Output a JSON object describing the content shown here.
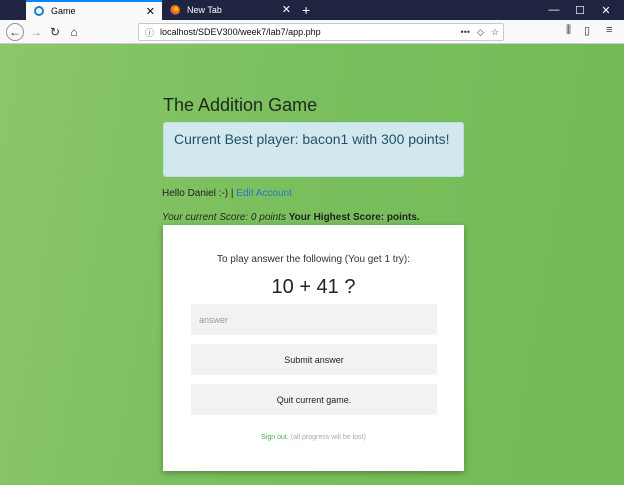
{
  "browser": {
    "tabs": [
      {
        "title": "Game",
        "active": true,
        "favicon": "game-icon"
      },
      {
        "title": "New Tab",
        "active": false,
        "favicon": "firefox-icon"
      }
    ],
    "url_prefix": "localhost",
    "url_path": "/SDEV300/week7/lab7/app.php",
    "url_more": "•••"
  },
  "page": {
    "title": "The Addition Game",
    "best_player": "Current Best player: bacon1 with 300 points!",
    "greeting": "Hello Daniel :-) | ",
    "edit_account": "Edit Account",
    "current_score": "Your current Score: 0 points",
    "highest_score": "Your Highest Score: points."
  },
  "game": {
    "instructions": "To play answer the following (You get 1 try):",
    "question": "10 + 41 ?",
    "answer_placeholder": "answer",
    "submit_label": "Submit answer",
    "quit_label": "Quit current game.",
    "signout_link": "Sign out.",
    "signout_note": " (all progress will be lost)"
  },
  "colors": {
    "background": "#7bbf5e",
    "alert_bg": "#d1e8ee",
    "link": "#2a76c6",
    "signout": "#4caf50"
  }
}
